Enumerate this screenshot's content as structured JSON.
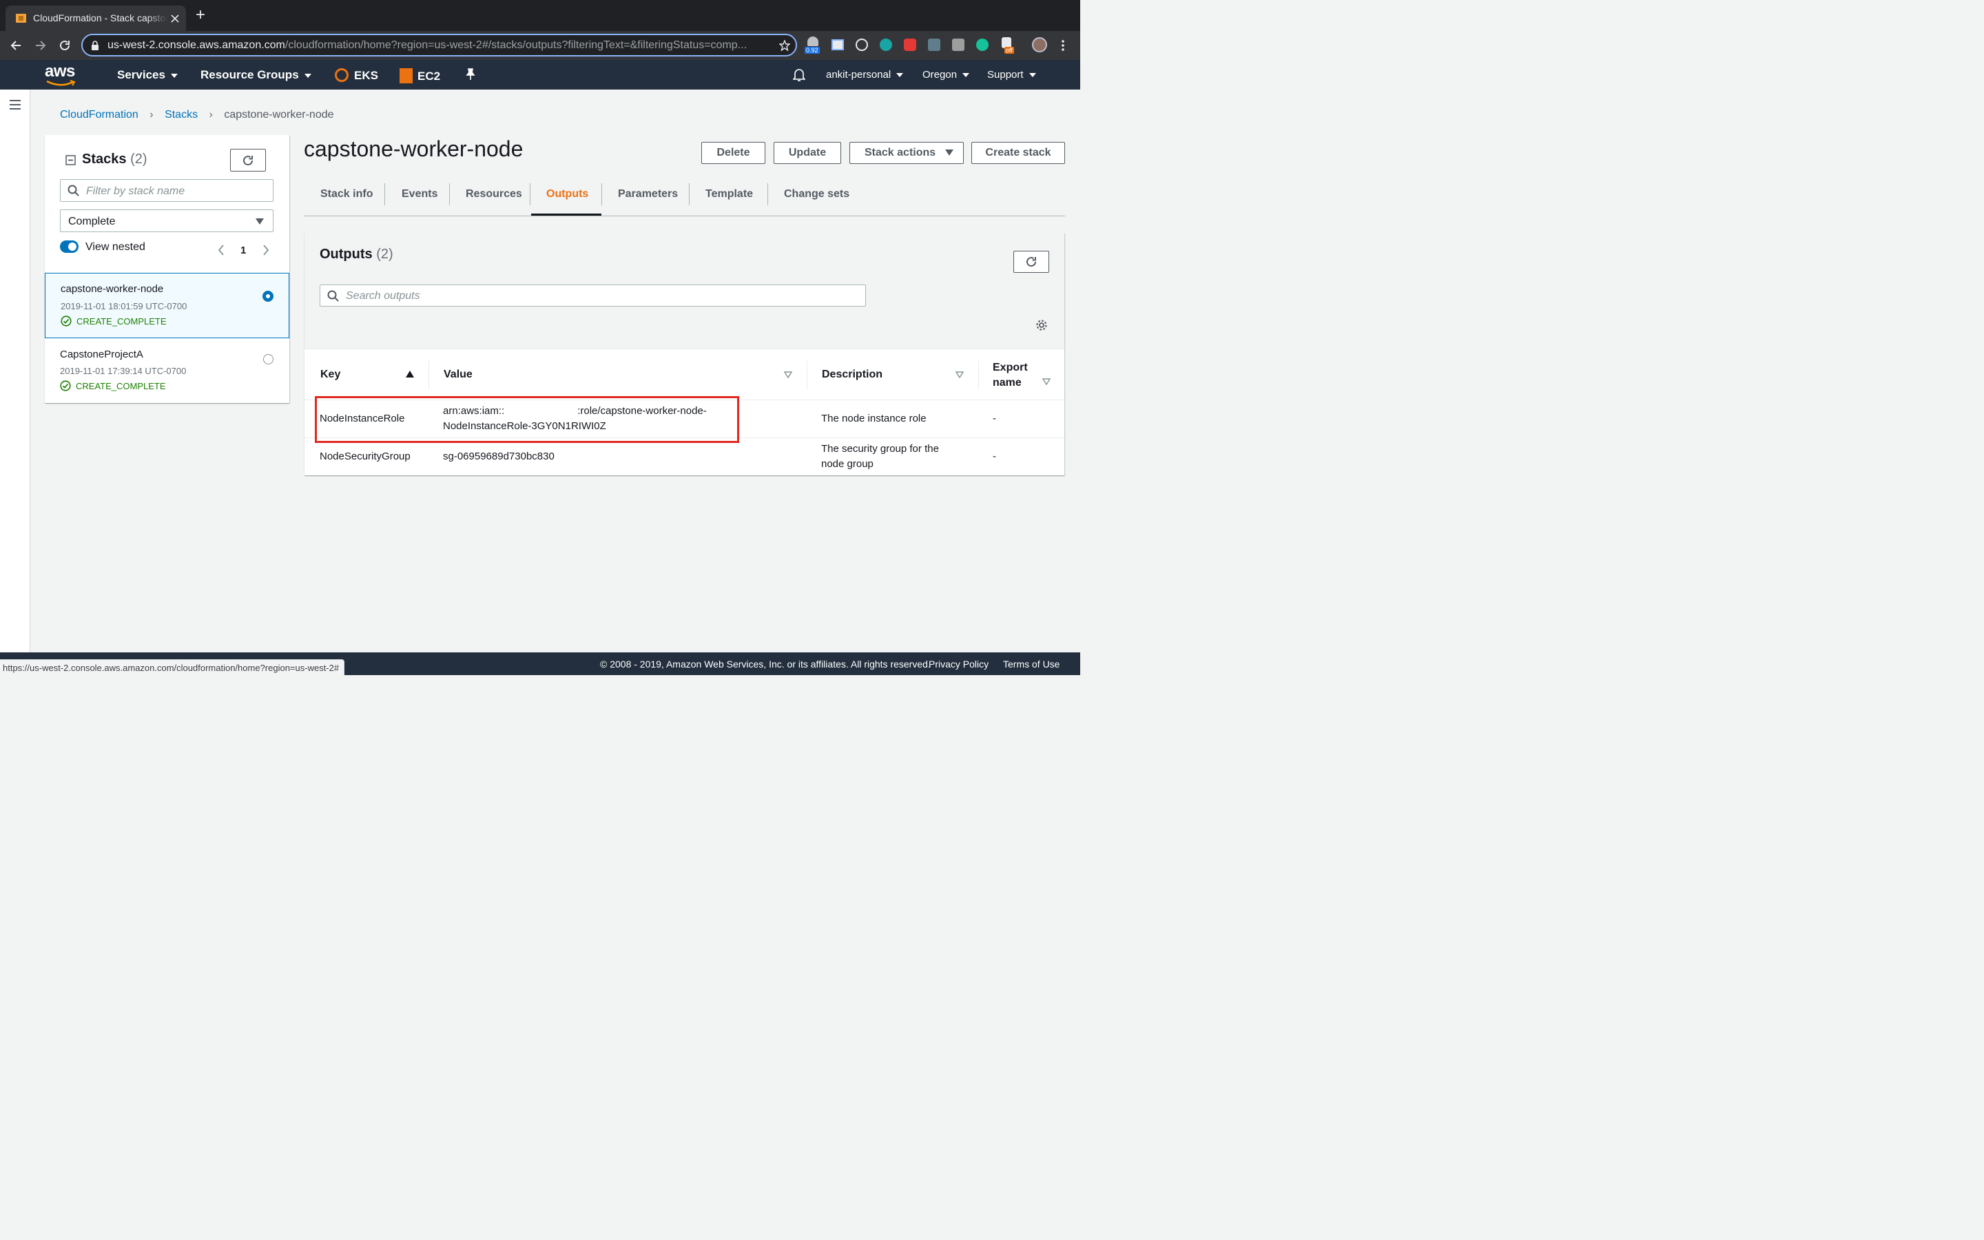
{
  "browser": {
    "tab_title": "CloudFormation - Stack capstone-worker-node",
    "new_tab": "+",
    "url_host": "us-west-2.console.aws.amazon.com",
    "url_path": "/cloudformation/home?region=us-west-2#/stacks/outputs?filteringText=&filteringStatus=comp...",
    "extension_badge_1": "0.92",
    "extension_badge_2": "off",
    "status_url": "https://us-west-2.console.aws.amazon.com/cloudformation/home?region=us-west-2#"
  },
  "aws_nav": {
    "logo": "aws",
    "services": "Services",
    "resource_groups": "Resource Groups",
    "eks": "EKS",
    "ec2": "EC2",
    "account": "ankit-personal",
    "region": "Oregon",
    "support": "Support"
  },
  "breadcrumb": [
    "CloudFormation",
    "Stacks",
    "capstone-worker-node"
  ],
  "stacks_panel": {
    "title": "Stacks",
    "count": "(2)",
    "filter_placeholder": "Filter by stack name",
    "status_filter": "Complete",
    "view_nested": "View nested",
    "view_nested_on": true,
    "page": "1",
    "items": [
      {
        "name": "capstone-worker-node",
        "date": "2019-11-01 18:01:59 UTC-0700",
        "status": "CREATE_COMPLETE",
        "selected": true
      },
      {
        "name": "CapstoneProjectA",
        "date": "2019-11-01 17:39:14 UTC-0700",
        "status": "CREATE_COMPLETE",
        "selected": false
      }
    ]
  },
  "stack": {
    "title": "capstone-worker-node",
    "actions": {
      "delete": "Delete",
      "update": "Update",
      "stack_actions": "Stack actions",
      "create": "Create stack"
    },
    "tabs": [
      "Stack info",
      "Events",
      "Resources",
      "Outputs",
      "Parameters",
      "Template",
      "Change sets"
    ],
    "active_tab": "Outputs"
  },
  "outputs": {
    "title": "Outputs",
    "count": "(2)",
    "search_placeholder": "Search outputs",
    "columns": {
      "key": "Key",
      "value": "Value",
      "description": "Description",
      "export_1": "Export",
      "export_2": "name"
    },
    "rows": [
      {
        "key": "NodeInstanceRole",
        "value_1a": "arn:aws:iam::",
        "value_1b": ":role/capstone-worker-node-",
        "value_2": "NodeInstanceRole-3GY0N1RIWI0Z",
        "description_1": "The node instance role",
        "description_2": "",
        "export": "-"
      },
      {
        "key": "NodeSecurityGroup",
        "value_1a": "sg-06959689d730bc830",
        "value_1b": "",
        "value_2": "",
        "description_1": "The security group for the",
        "description_2": "node group",
        "export": "-"
      }
    ],
    "highlight_color": "#e02a20"
  },
  "footer": {
    "copyright": "© 2008 - 2019, Amazon Web Services, Inc. or its affiliates. All rights reserved.",
    "privacy": "Privacy Policy",
    "terms": "Terms of Use"
  },
  "colors": {
    "accent_orange": "#ec7211",
    "link_blue": "#0073bb",
    "nav_bg": "#232f3e",
    "success_green": "#1d8102"
  }
}
